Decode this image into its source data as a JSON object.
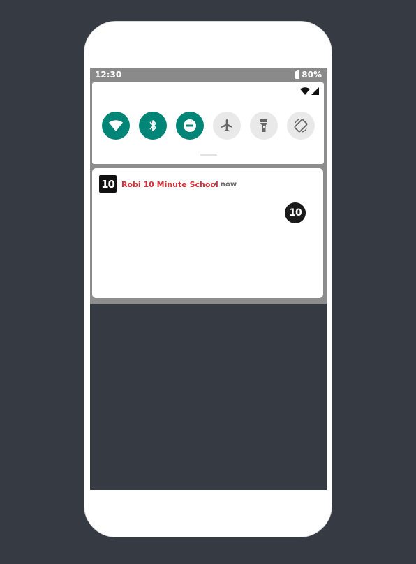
{
  "statusbar": {
    "time": "12:30",
    "battery": "80%"
  },
  "quick_settings": {
    "tiles": [
      {
        "name": "wifi",
        "active": true
      },
      {
        "name": "bluetooth",
        "active": true
      },
      {
        "name": "do-not-disturb",
        "active": true
      },
      {
        "name": "airplane-mode",
        "active": false
      },
      {
        "name": "flashlight",
        "active": false
      },
      {
        "name": "auto-rotate",
        "active": false
      }
    ],
    "active_color": "#018577",
    "inactive_color": "#e9e9e9"
  },
  "notification": {
    "app_icon_text": "10",
    "app_name": "Robi 10 Minute School",
    "time": "• now",
    "app_name_color": "#d6323a"
  }
}
